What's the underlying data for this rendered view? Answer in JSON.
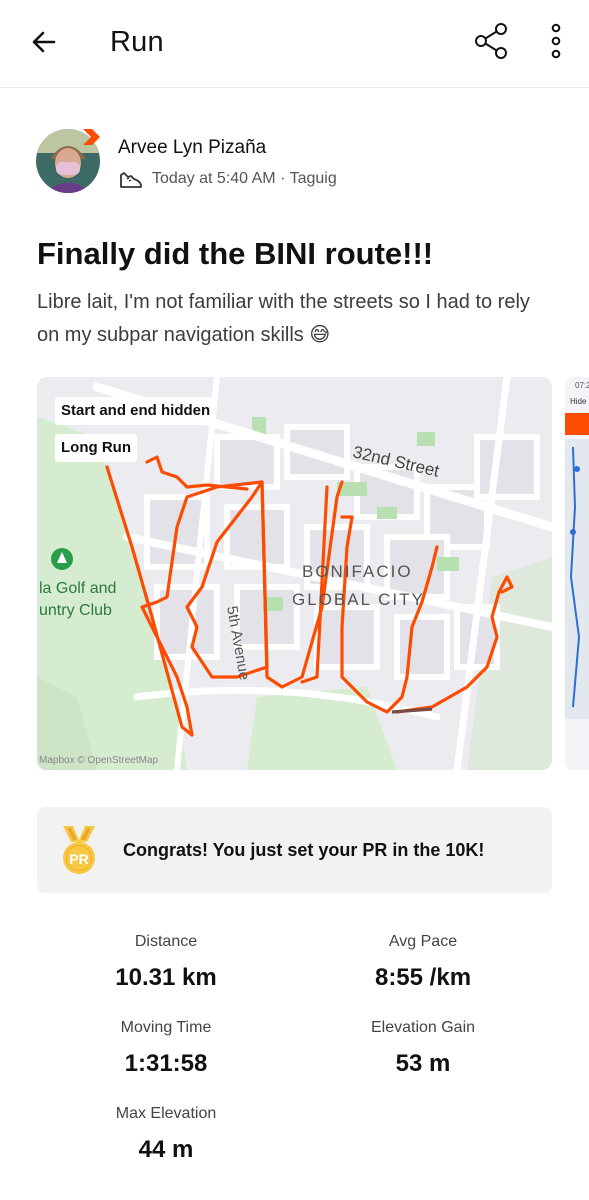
{
  "header": {
    "title": "Run",
    "back_icon": "arrow-left-icon",
    "share_icon": "share-icon",
    "more_icon": "more-vertical-icon"
  },
  "activity": {
    "author_name": "Arvee Lyn Pizaña",
    "time_location": "Today at 5:40 AM · Taguig",
    "activity_icon": "shoe-icon",
    "title": "Finally did the BINI route!!!",
    "description": "Libre lait, I'm not familiar with the streets so I had to rely on my subpar navigation skills 😅"
  },
  "map": {
    "tags": [
      "Start and end hidden",
      "Long Run"
    ],
    "labels": {
      "street": "32nd Street",
      "district_line1": "BONIFACIO",
      "district_line2": "GLOBAL CITY",
      "golf_line1": "la Golf and",
      "golf_line2": "untry Club",
      "avenue": "5th Avenue",
      "attribution": "Mapbox © OpenStreetMap"
    },
    "route_color": "#fc4c02"
  },
  "pr_banner": {
    "text": "Congrats! You just set your PR in the 10K!",
    "medal_icon": "pr-medal-icon",
    "medal_label": "PR"
  },
  "stats": [
    {
      "label": "Distance",
      "value": "10.31 km"
    },
    {
      "label": "Avg Pace",
      "value": "8:55 /km"
    },
    {
      "label": "Moving Time",
      "value": "1:31:58"
    },
    {
      "label": "Elevation Gain",
      "value": "53 m"
    },
    {
      "label": "Max Elevation",
      "value": "44 m"
    }
  ],
  "peek": {
    "time": "07:2",
    "hide": "Hide"
  }
}
